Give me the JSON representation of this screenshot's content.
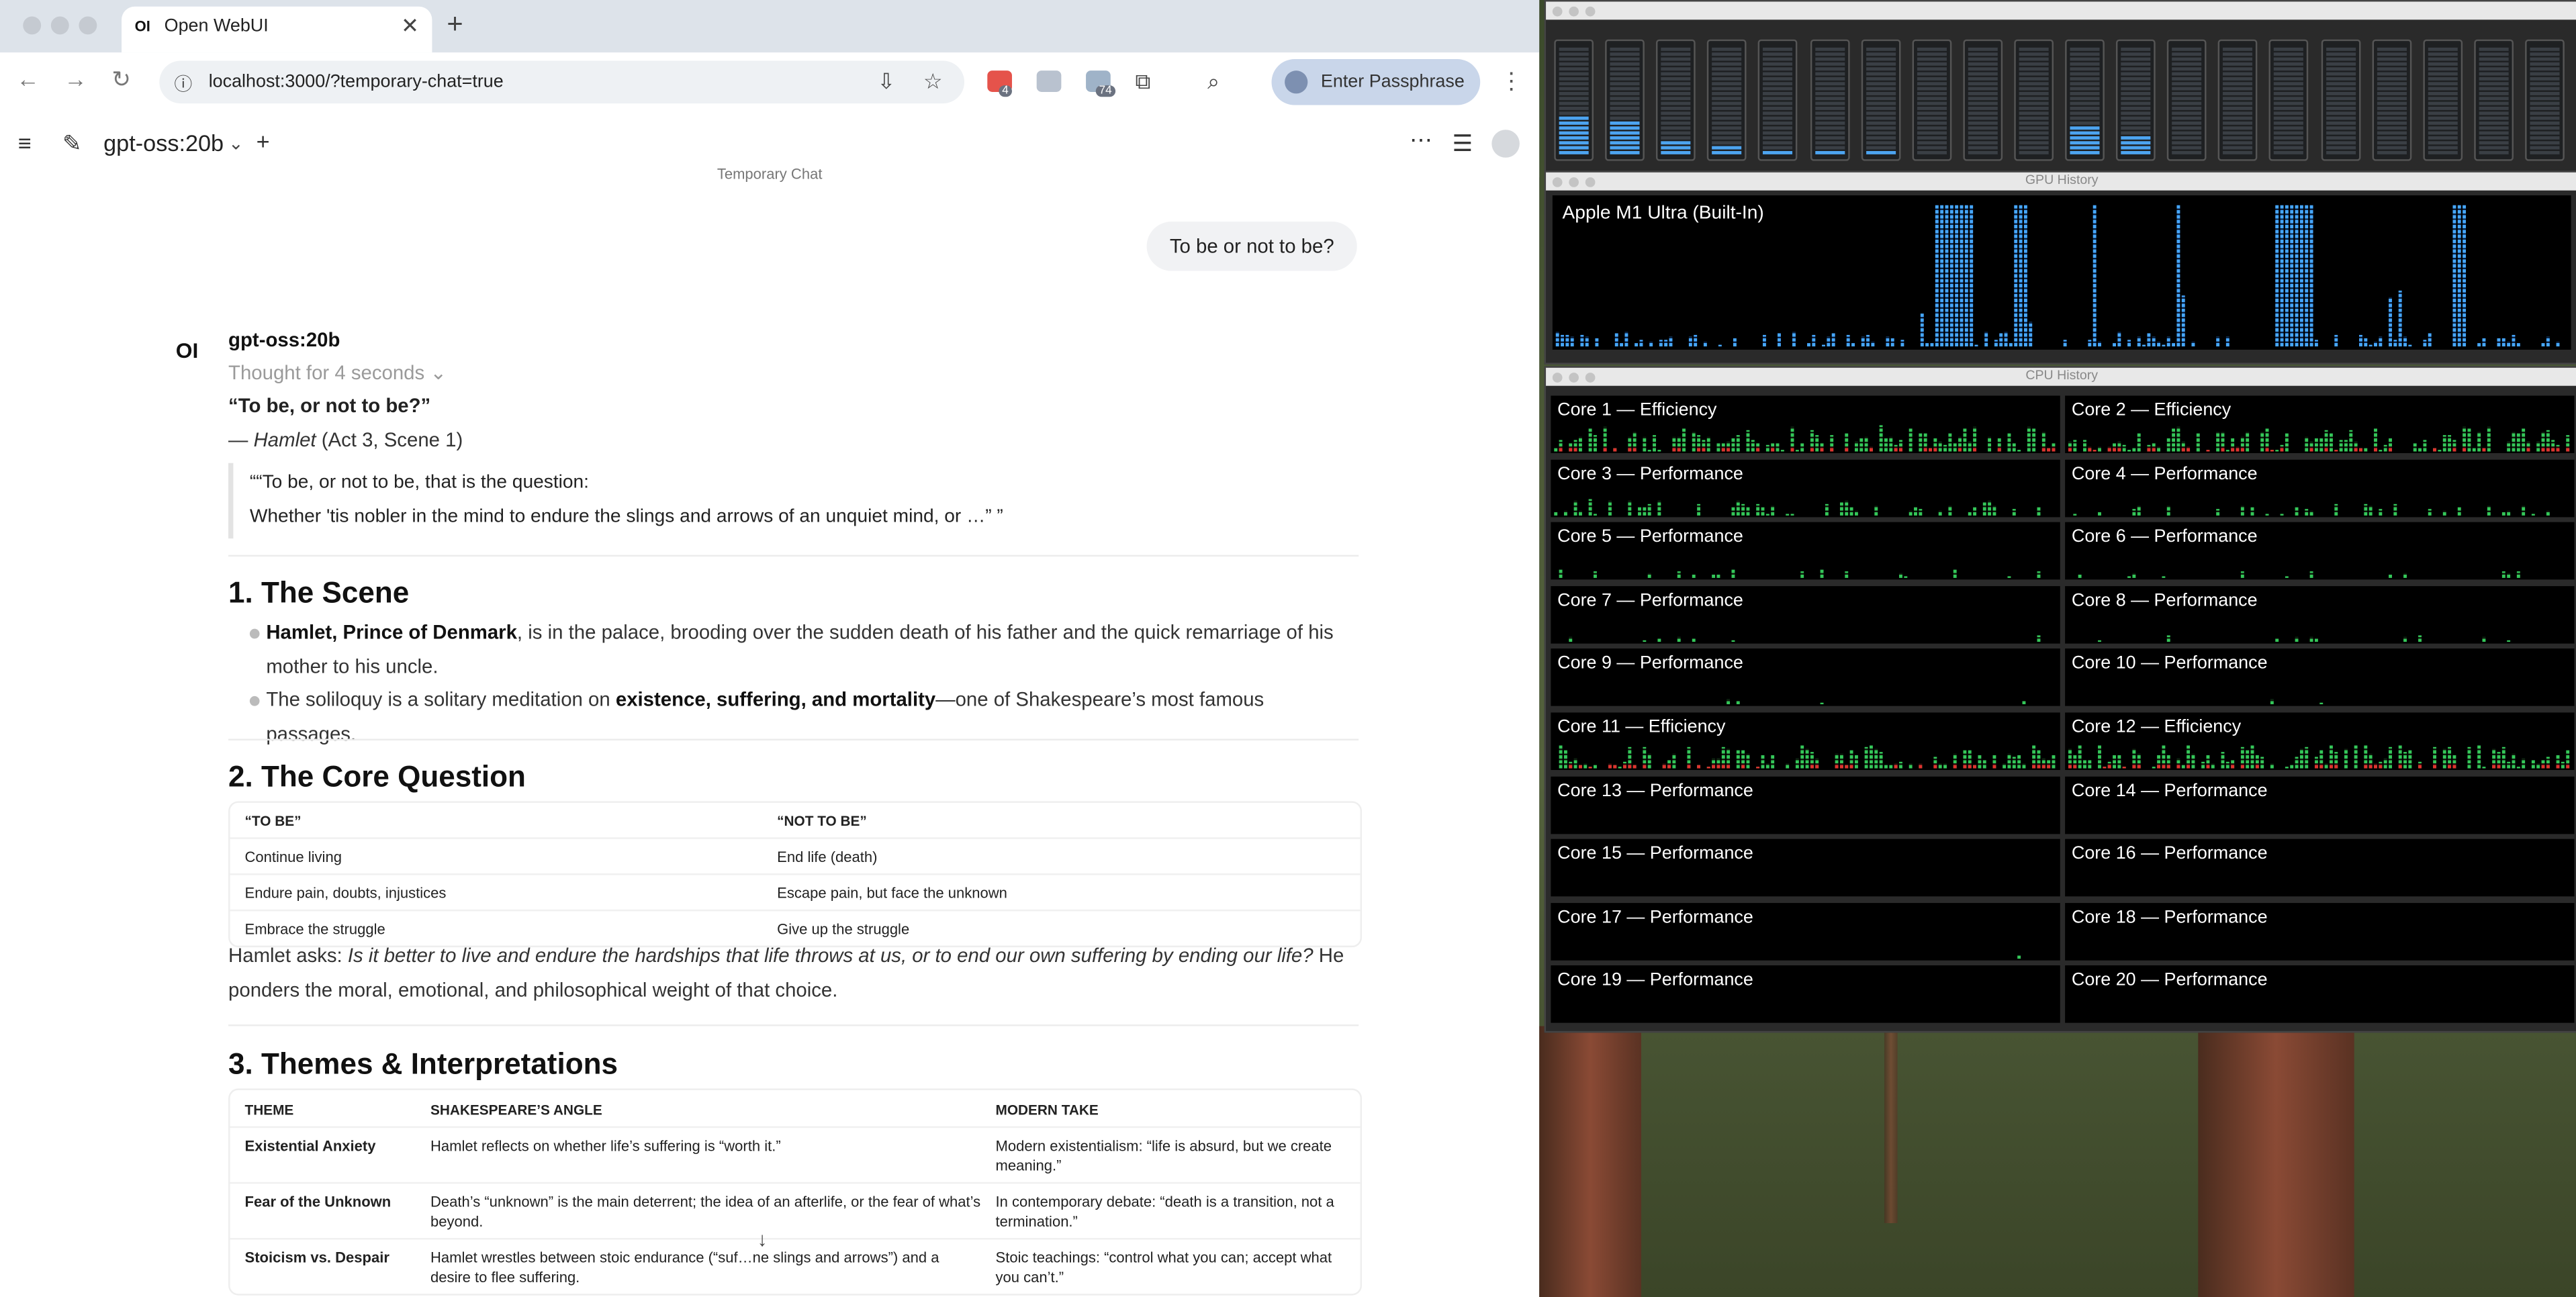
{
  "browser": {
    "tab_title": "Open WebUI",
    "tab_favicon": "OI",
    "url": "localhost:3000/?temporary-chat=true",
    "passphrase_label": "Enter Passphrase",
    "ext_badges": [
      "4",
      "74"
    ]
  },
  "app": {
    "model": "gpt-oss:20b",
    "temporary_label": "Temporary Chat"
  },
  "chat": {
    "user_message": "To be or not to be?",
    "assistant_logo": "OI",
    "assistant_name": "gpt-oss:20b",
    "thought": "Thought for 4 seconds",
    "quote_title": "“To be, or not to be?”",
    "quote_src_prefix": "— ",
    "quote_src_work": "Hamlet",
    "quote_src_rest": " (Act 3, Scene 1)",
    "blockquote": [
      "““To be, or not to be, that is the question:",
      "Whether 'tis nobler in the mind to endure the slings and arrows of an unquiet mind, or …” ”"
    ],
    "section1": {
      "heading": "1. The Scene",
      "b1_bold": "Hamlet, Prince of Denmark",
      "b1_rest": ", is in the palace, brooding over the sudden death of his father and the quick remarriage of his mother to his uncle.",
      "b2_pre": "The soliloquy is a solitary meditation on ",
      "b2_bold": "existence, suffering, and mortality",
      "b2_post": "—one of Shakespeare’s most famous passages."
    },
    "section2": {
      "heading": "2. The Core Question",
      "headers": [
        "“TO BE”",
        "“NOT TO BE”"
      ],
      "rows": [
        [
          "Continue living",
          "End life (death)"
        ],
        [
          "Endure pain, doubts, injustices",
          "Escape pain, but face the unknown"
        ],
        [
          "Embrace the struggle",
          "Give up the struggle"
        ]
      ],
      "p_pre": "Hamlet asks: ",
      "p_italic": "Is it better to live and endure the hardships that life throws at us, or to end our own suffering by ending our life?",
      "p_post": " He ponders the moral, emotional, and philosophical weight of that choice."
    },
    "section3": {
      "heading": "3. Themes & Interpretations",
      "headers": [
        "THEME",
        "SHAKESPEARE’S ANGLE",
        "MODERN TAKE"
      ],
      "rows": [
        [
          "Existential Anxiety",
          "Hamlet reflects on whether life’s suffering is “worth it.”",
          "Modern existentialism: “life is absurd, but we create meaning.”"
        ],
        [
          "Fear of the Unknown",
          "Death’s “unknown” is the main deterrent; the idea of an afterlife, or the fear of what’s beyond.",
          "In contemporary debate: “death is a transition, not a termination.”"
        ],
        [
          "Stoicism vs. Despair",
          "Hamlet wrestles between stoic endurance (“suf…ne slings and arrows”) and a desire to flee suffering.",
          "Stoic teachings: “control what you can; accept what you can’t.”"
        ]
      ]
    }
  },
  "monitor": {
    "gpu_window_title": "GPU History",
    "gpu_name": "Apple M1 Ultra (Built-In)",
    "cpu_window_title": "CPU History",
    "meter_levels": [
      0.36,
      0.32,
      0.14,
      0.07,
      0.05,
      0.05,
      0.05,
      0.0,
      0.0,
      0.0,
      0.27,
      0.19,
      0.0,
      0.0,
      0.0,
      0.0,
      0.0,
      0.0,
      0.0,
      0.0
    ],
    "cores": [
      {
        "label": "Core 1 — Efficiency",
        "activity": 0.55
      },
      {
        "label": "Core 2 — Efficiency",
        "activity": 0.55
      },
      {
        "label": "Core 3 — Performance",
        "activity": 0.3
      },
      {
        "label": "Core 4 — Performance",
        "activity": 0.2
      },
      {
        "label": "Core 5 — Performance",
        "activity": 0.12
      },
      {
        "label": "Core 6 — Performance",
        "activity": 0.1
      },
      {
        "label": "Core 7 — Performance",
        "activity": 0.08
      },
      {
        "label": "Core 8 — Performance",
        "activity": 0.06
      },
      {
        "label": "Core 9 — Performance",
        "activity": 0.02
      },
      {
        "label": "Core 10 — Performance",
        "activity": 0.02
      },
      {
        "label": "Core 11 — Efficiency",
        "activity": 0.5
      },
      {
        "label": "Core 12 — Efficiency",
        "activity": 0.5
      },
      {
        "label": "Core 13 — Performance",
        "activity": 0.0
      },
      {
        "label": "Core 14 — Performance",
        "activity": 0.0
      },
      {
        "label": "Core 15 — Performance",
        "activity": 0.0
      },
      {
        "label": "Core 16 — Performance",
        "activity": 0.0
      },
      {
        "label": "Core 17 — Performance",
        "activity": 0.01
      },
      {
        "label": "Core 18 — Performance",
        "activity": 0.0
      },
      {
        "label": "Core 19 — Performance",
        "activity": 0.0
      },
      {
        "label": "Core 20 — Performance",
        "activity": 0.0
      }
    ],
    "colors": {
      "gpu": "#46a7ff",
      "cpu_user": "#34c759",
      "cpu_system": "#e0332f"
    }
  }
}
